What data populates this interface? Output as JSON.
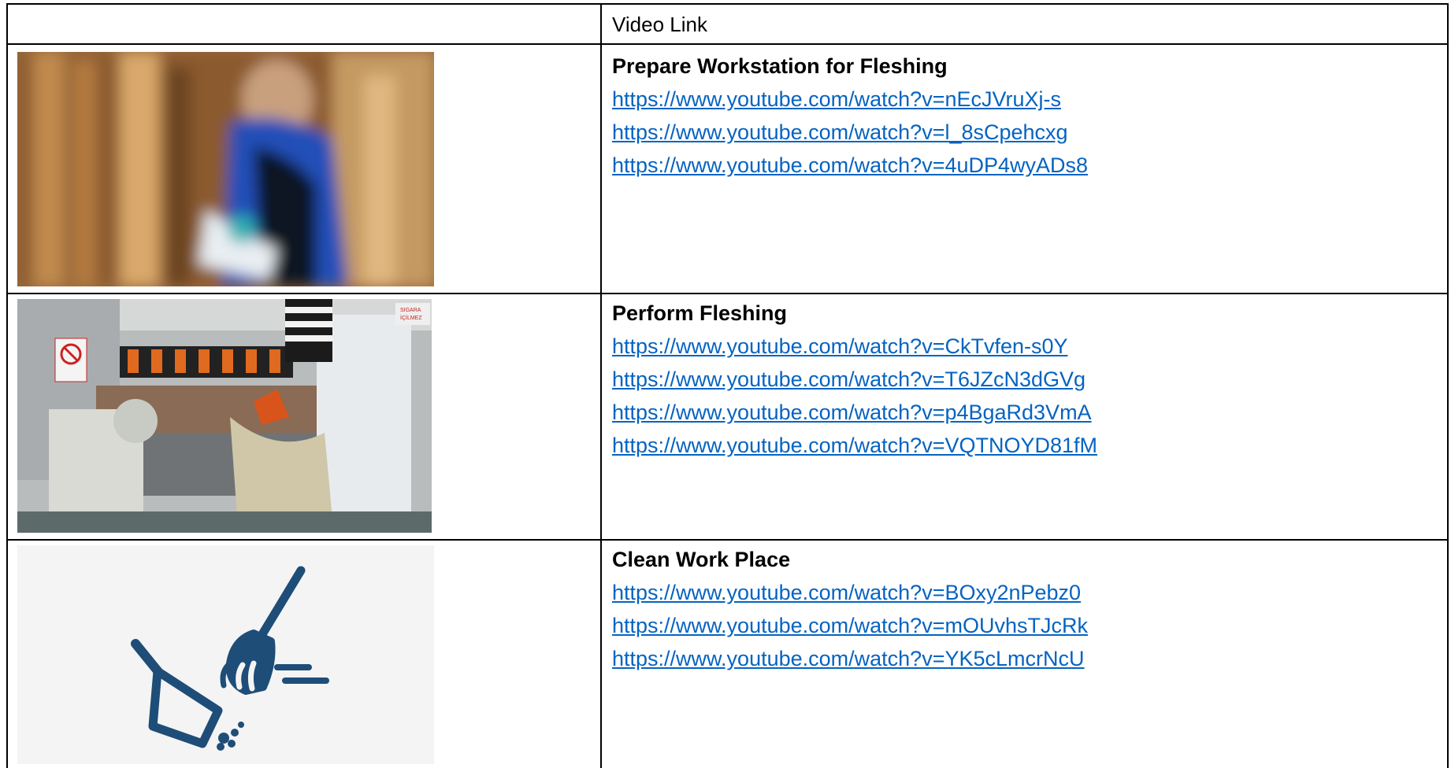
{
  "table": {
    "header": {
      "left": "",
      "right": "Video Link"
    },
    "rows": [
      {
        "title": "Prepare Workstation for Fleshing",
        "links": [
          "https://www.youtube.com/watch?v=nEcJVruXj-s",
          "https://www.youtube.com/watch?v=l_8sCpehcxg",
          "https://www.youtube.com/watch?v=4uDP4wyADs8"
        ],
        "image": "blurred-worker-photo"
      },
      {
        "title": "Perform Fleshing",
        "links": [
          "https://www.youtube.com/watch?v=CkTvfen-s0Y",
          "https://www.youtube.com/watch?v=T6JZcN3dGVg",
          "https://www.youtube.com/watch?v=p4BgaRd3VmA",
          "https://www.youtube.com/watch?v=VQTNOYD81fM"
        ],
        "image": "fleshing-machine-photo",
        "image_sign_text": "SIGARA İÇİLMEZ"
      },
      {
        "title": "Clean Work Place",
        "links": [
          "https://www.youtube.com/watch?v=BOxy2nPebz0",
          "https://www.youtube.com/watch?v=mOUvhsTJcRk",
          "https://www.youtube.com/watch?v=YK5cLmcrNcU"
        ],
        "image": "mop-and-dustpan-icon"
      }
    ]
  },
  "colors": {
    "link": "#0563c1",
    "icon": "#1e4d78",
    "border": "#000000"
  }
}
